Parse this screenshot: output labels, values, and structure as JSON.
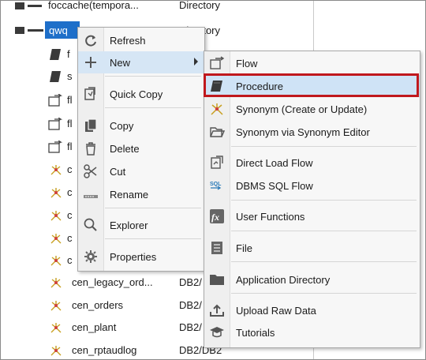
{
  "tree": {
    "rows": [
      {
        "name": "foccache(tempora...",
        "type": "Directory"
      },
      {
        "name": "qwq",
        "type": "Directory"
      },
      {
        "name": "f",
        "type": ""
      },
      {
        "name": "s",
        "type": ""
      },
      {
        "name": "fl",
        "type": ""
      },
      {
        "name": "fl",
        "type": ""
      },
      {
        "name": "fl",
        "type": ""
      },
      {
        "name": "c",
        "type": ""
      },
      {
        "name": "c",
        "type": ""
      },
      {
        "name": "c",
        "type": ""
      },
      {
        "name": "c",
        "type": ""
      },
      {
        "name": "c",
        "type": ""
      },
      {
        "name": "cen_legacy_ord...",
        "type": "DB2/"
      },
      {
        "name": "cen_orders",
        "type": "DB2/"
      },
      {
        "name": "cen_plant",
        "type": "DB2/"
      },
      {
        "name": "cen_rptaudlog",
        "type": "DB2/DB2"
      }
    ]
  },
  "context_menu": {
    "items": [
      {
        "label": "Refresh",
        "icon": "refresh-icon"
      },
      {
        "label": "New",
        "icon": "plus-icon"
      },
      {
        "label": "Quick Copy",
        "icon": "quick-copy-icon"
      },
      {
        "label": "Copy",
        "icon": "copy-icon"
      },
      {
        "label": "Delete",
        "icon": "trash-icon"
      },
      {
        "label": "Cut",
        "icon": "scissors-icon"
      },
      {
        "label": "Rename",
        "icon": "rename-icon"
      },
      {
        "label": "Explorer",
        "icon": "search-icon"
      },
      {
        "label": "Properties",
        "icon": "gear-icon"
      }
    ]
  },
  "submenu": {
    "items": [
      {
        "label": "Flow",
        "icon": "flow-icon"
      },
      {
        "label": "Procedure",
        "icon": "procedure-icon"
      },
      {
        "label": "Synonym (Create or Update)",
        "icon": "synonym-icon"
      },
      {
        "label": "Synonym via Synonym Editor",
        "icon": "folder-open-icon"
      },
      {
        "label": "Direct Load Flow",
        "icon": "direct-load-icon"
      },
      {
        "label": "DBMS SQL Flow",
        "icon": "sql-icon"
      },
      {
        "label": "User Functions",
        "icon": "fx-icon"
      },
      {
        "label": "File",
        "icon": "file-icon"
      },
      {
        "label": "Application Directory",
        "icon": "folder-icon"
      },
      {
        "label": "Upload Raw Data",
        "icon": "upload-icon"
      },
      {
        "label": "Tutorials",
        "icon": "graduation-cap-icon"
      }
    ]
  },
  "colors": {
    "selection": "#1e6fc9",
    "highlight": "#cfe3f6",
    "callout": "#c0181d"
  }
}
